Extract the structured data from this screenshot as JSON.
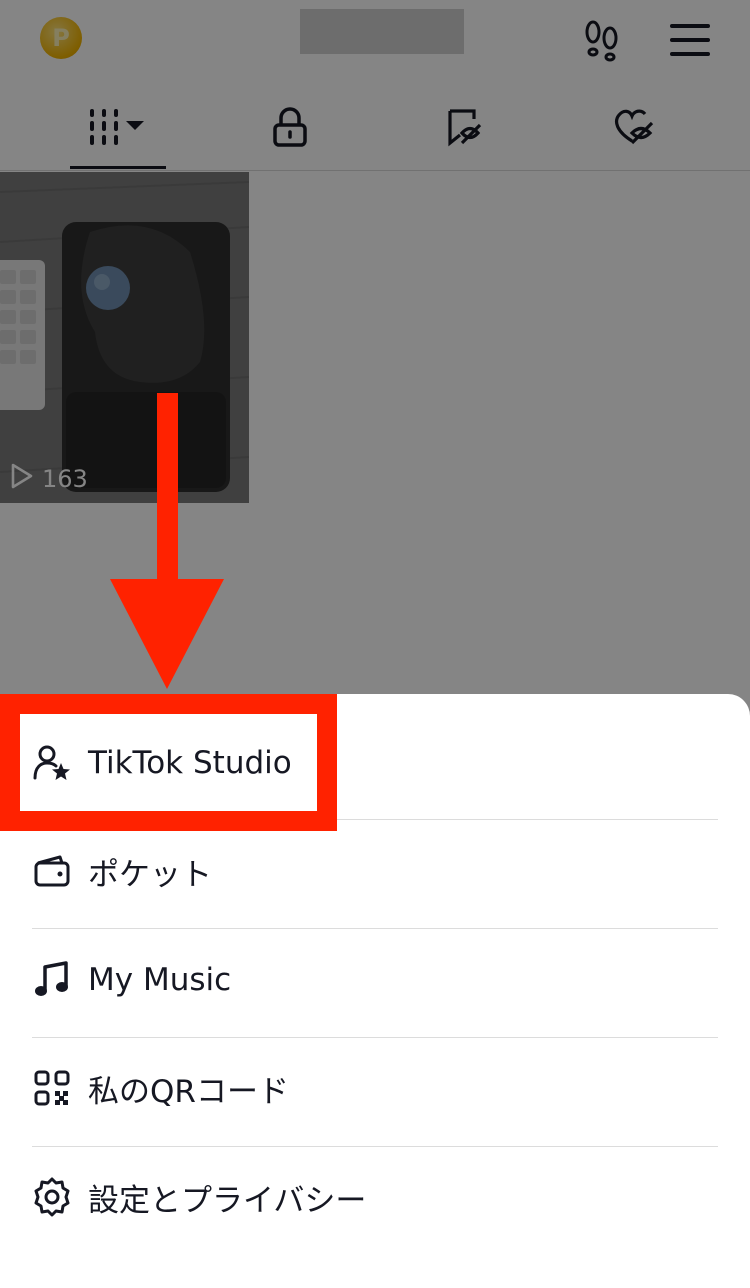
{
  "header": {
    "coin_icon": "coin-icon",
    "coin_glyph": "P",
    "footprint_icon": "footprint-icon",
    "menu_icon": "hamburger-menu-icon"
  },
  "tabs": [
    {
      "icon": "videos-grid-icon",
      "selected": true
    },
    {
      "icon": "lock-icon",
      "selected": false
    },
    {
      "icon": "hidden-bookmark-icon",
      "selected": false
    },
    {
      "icon": "hidden-liked-icon",
      "selected": false
    }
  ],
  "video": {
    "views": "163",
    "play_icon": "play-outline-icon"
  },
  "menu": {
    "items": [
      {
        "label": "TikTok Studio",
        "icon": "person-star-icon"
      },
      {
        "label": "ポケット",
        "icon": "wallet-icon"
      },
      {
        "label": "My Music",
        "icon": "music-note-icon"
      },
      {
        "label": "私のQRコード",
        "icon": "qr-code-icon"
      },
      {
        "label": "設定とプライバシー",
        "icon": "settings-gear-icon"
      }
    ]
  },
  "colors": {
    "annotation": "#ff2200",
    "text": "#161823",
    "coin": "#f2b400"
  }
}
